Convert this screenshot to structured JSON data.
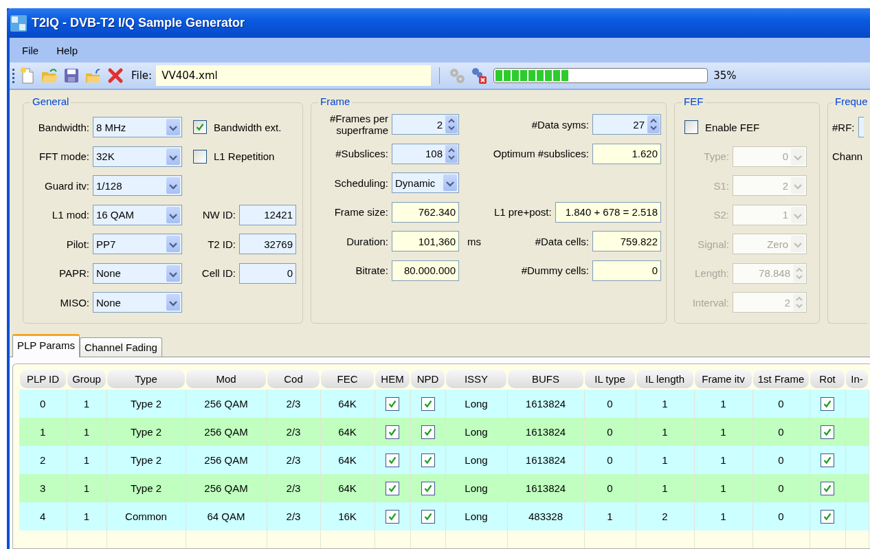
{
  "window": {
    "title": "T2IQ - DVB-T2 I/Q Sample Generator"
  },
  "menu": [
    {
      "label": "File"
    },
    {
      "label": "Help"
    }
  ],
  "toolbar": {
    "file_label": "File:",
    "file_value": "VV404.xml",
    "progress": {
      "level": 0.35
    },
    "progress_text": "35%"
  },
  "general": {
    "title": "General",
    "rows": [
      [
        {
          "kind": "combo",
          "label": "Bandwidth:",
          "value": "8 MHz"
        },
        {
          "kind": "check",
          "label": "Bandwidth ext.",
          "checked": true
        }
      ],
      [
        {
          "kind": "combo",
          "label": "FFT mode:",
          "value": "32K"
        },
        {
          "kind": "check",
          "label": "L1 Repetition",
          "checked": false
        }
      ],
      [
        {
          "kind": "combo",
          "label": "Guard itv:",
          "value": "1/128"
        }
      ],
      [
        {
          "kind": "combo",
          "label": "L1 mod:",
          "value": "16 QAM"
        },
        {
          "kind": "input",
          "label": "NW ID:",
          "value": "12421"
        }
      ],
      [
        {
          "kind": "combo",
          "label": "Pilot:",
          "value": "PP7"
        },
        {
          "kind": "input",
          "label": "T2 ID:",
          "value": "32769"
        }
      ],
      [
        {
          "kind": "combo",
          "label": "PAPR:",
          "value": "None"
        },
        {
          "kind": "input",
          "label": "Cell ID:",
          "value": "0"
        }
      ],
      [
        {
          "kind": "combo",
          "label": "MISO:",
          "value": "None"
        }
      ]
    ]
  },
  "frame": {
    "title": "Frame",
    "rows": [
      [
        {
          "kind": "spin",
          "label": "#Frames per superframe",
          "value": "2"
        },
        {
          "kind": "spin",
          "label": "#Data syms:",
          "value": "27"
        }
      ],
      [
        {
          "kind": "spin",
          "label": "#Subslices:",
          "value": "108"
        },
        {
          "kind": "readout",
          "label": "Optimum #subslices:",
          "value": "1.620"
        }
      ],
      [
        {
          "kind": "combo",
          "label": "Scheduling:",
          "value": "Dynamic"
        }
      ],
      [
        {
          "kind": "readout",
          "label": "Frame size:",
          "value": "762.340"
        },
        {
          "kind": "readout",
          "label": "L1 pre+post:",
          "value": "1.840 + 678 = 2.518"
        }
      ],
      [
        {
          "kind": "readout",
          "label": "Duration:",
          "value": "101,360",
          "unit": "ms"
        },
        {
          "kind": "readout",
          "label": "#Data cells:",
          "value": "759.822"
        }
      ],
      [
        {
          "kind": "readout",
          "label": "Bitrate:",
          "value": "80.000.000"
        },
        {
          "kind": "readout",
          "label": "#Dummy cells:",
          "value": "0"
        }
      ]
    ]
  },
  "fef": {
    "title": "FEF",
    "rows": [
      [
        {
          "kind": "check",
          "label": "Enable FEF",
          "checked": false
        }
      ],
      [
        {
          "kind": "combo",
          "label": "Type:",
          "value": "0",
          "disabled": true
        }
      ],
      [
        {
          "kind": "combo",
          "label": "S1:",
          "value": "2",
          "disabled": true
        }
      ],
      [
        {
          "kind": "combo",
          "label": "S2:",
          "value": "1",
          "disabled": true
        }
      ],
      [
        {
          "kind": "combo",
          "label": "Signal:",
          "value": "Zero",
          "disabled": true
        }
      ],
      [
        {
          "kind": "spin",
          "label": "Length:",
          "value": "78.848",
          "disabled": true
        }
      ],
      [
        {
          "kind": "spin",
          "label": "Interval:",
          "value": "2",
          "disabled": true
        }
      ]
    ]
  },
  "frequency": {
    "title": "Freque",
    "rows": [
      [
        {
          "kind": "input",
          "label": "#RF:"
        }
      ],
      [
        {
          "kind": "text",
          "label": "Chann"
        }
      ]
    ]
  },
  "tabs": [
    {
      "label": "PLP Params",
      "selected": true
    },
    {
      "label": "Channel Fading",
      "selected": false
    }
  ],
  "table": {
    "columns": [
      {
        "label": "PLP ID",
        "kind": "text"
      },
      {
        "label": "Group",
        "kind": "text"
      },
      {
        "label": "Type",
        "kind": "text"
      },
      {
        "label": "Mod",
        "kind": "text"
      },
      {
        "label": "Cod",
        "kind": "text"
      },
      {
        "label": "FEC",
        "kind": "text"
      },
      {
        "label": "HEM",
        "kind": "check"
      },
      {
        "label": "NPD",
        "kind": "check"
      },
      {
        "label": "ISSY",
        "kind": "text"
      },
      {
        "label": "BUFS",
        "kind": "text"
      },
      {
        "label": "IL type",
        "kind": "text"
      },
      {
        "label": "IL length",
        "kind": "text"
      },
      {
        "label": "Frame itv",
        "kind": "text"
      },
      {
        "label": "1st Frame",
        "kind": "text"
      },
      {
        "label": "Rot",
        "kind": "check"
      },
      {
        "label": "In-",
        "kind": "text"
      }
    ],
    "rows": [
      {
        "cells": [
          "0",
          "1",
          "Type 2",
          "256 QAM",
          "2/3",
          "64K",
          true,
          true,
          "Long",
          "1613824",
          "0",
          "1",
          "1",
          "0",
          true,
          ""
        ]
      },
      {
        "cells": [
          "1",
          "1",
          "Type 2",
          "256 QAM",
          "2/3",
          "64K",
          true,
          true,
          "Long",
          "1613824",
          "0",
          "1",
          "1",
          "0",
          true,
          ""
        ]
      },
      {
        "cells": [
          "2",
          "1",
          "Type 2",
          "256 QAM",
          "2/3",
          "64K",
          true,
          true,
          "Long",
          "1613824",
          "0",
          "1",
          "1",
          "0",
          true,
          ""
        ]
      },
      {
        "cells": [
          "3",
          "1",
          "Type 2",
          "256 QAM",
          "2/3",
          "64K",
          true,
          true,
          "Long",
          "1613824",
          "0",
          "1",
          "1",
          "0",
          true,
          ""
        ]
      },
      {
        "cells": [
          "4",
          "1",
          "Common",
          "64 QAM",
          "2/3",
          "16K",
          true,
          true,
          "Long",
          "483328",
          "1",
          "2",
          "1",
          "0",
          true,
          ""
        ]
      }
    ]
  }
}
